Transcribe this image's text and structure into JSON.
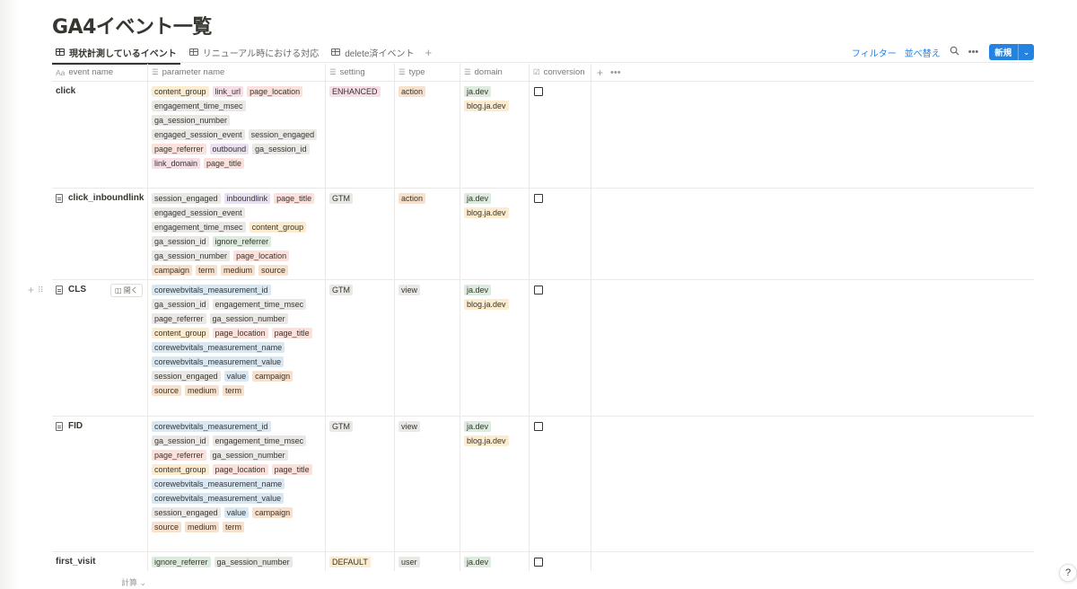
{
  "page": {
    "title": "GA4イベント一覧"
  },
  "views": {
    "tabs": [
      {
        "label": "現状計測しているイベント",
        "active": true
      },
      {
        "label": "リニューアル時における対応",
        "active": false
      },
      {
        "label": "delete済イベント",
        "active": false
      }
    ],
    "add_label": "+"
  },
  "toolbar": {
    "filter_label": "フィルター",
    "sort_label": "並べ替え",
    "search_icon": "search-icon",
    "more_icon": "more-icon",
    "new_label": "新規",
    "new_drop": "⌄"
  },
  "columns": [
    {
      "key": "event",
      "label": "event name",
      "icon": "Aa"
    },
    {
      "key": "param",
      "label": "parameter name",
      "icon": "☰"
    },
    {
      "key": "setting",
      "label": "setting",
      "icon": "☰"
    },
    {
      "key": "type",
      "label": "type",
      "icon": "☰"
    },
    {
      "key": "domain",
      "label": "domain",
      "icon": "☰"
    },
    {
      "key": "conv",
      "label": "conversion",
      "icon": "☑"
    }
  ],
  "tag_colors": {
    "yellow": "#fbecd0",
    "pink": "#f6dde7",
    "red": "#fbe0dc",
    "gray": "#e9e8e5",
    "purple": "#e9e0f2",
    "blue": "#d8e7f2",
    "green": "#dcebdd",
    "orange": "#f8e1cc",
    "brown": "#efe2d8"
  },
  "rows": [
    {
      "name": "click",
      "doc_icon": false,
      "params": [
        [
          "content_group",
          "yellow"
        ],
        [
          "link_url",
          "pink"
        ],
        [
          "page_location",
          "red"
        ],
        [
          "engagement_time_msec",
          "gray"
        ],
        [
          "ga_session_number",
          "gray"
        ],
        [
          "engaged_session_event",
          "gray"
        ],
        [
          "session_engaged",
          "gray"
        ],
        [
          "page_referrer",
          "red"
        ],
        [
          "outbound",
          "purple"
        ],
        [
          "ga_session_id",
          "gray"
        ],
        [
          "link_domain",
          "pink"
        ],
        [
          "page_title",
          "red"
        ]
      ],
      "setting": [
        [
          "ENHANCED",
          "pink"
        ]
      ],
      "type": [
        [
          "action",
          "orange"
        ]
      ],
      "domain": [
        [
          "ja.dev",
          "green"
        ],
        [
          "blog.ja.dev",
          "yellow"
        ]
      ],
      "conversion": false
    },
    {
      "name": "click_inboundlink",
      "doc_icon": true,
      "params": [
        [
          "session_engaged",
          "gray"
        ],
        [
          "inboundlink",
          "purple"
        ],
        [
          "page_title",
          "red"
        ],
        [
          "engaged_session_event",
          "gray"
        ],
        [
          "engagement_time_msec",
          "gray"
        ],
        [
          "content_group",
          "yellow"
        ],
        [
          "ga_session_id",
          "gray"
        ],
        [
          "ignore_referrer",
          "green"
        ],
        [
          "ga_session_number",
          "gray"
        ],
        [
          "page_location",
          "red"
        ],
        [
          "campaign",
          "orange"
        ],
        [
          "term",
          "orange"
        ],
        [
          "medium",
          "orange"
        ],
        [
          "source",
          "orange"
        ]
      ],
      "setting": [
        [
          "GTM",
          "gray"
        ]
      ],
      "type": [
        [
          "action",
          "orange"
        ]
      ],
      "domain": [
        [
          "ja.dev",
          "green"
        ],
        [
          "blog.ja.dev",
          "yellow"
        ]
      ],
      "conversion": false
    },
    {
      "name": "CLS",
      "doc_icon": true,
      "hover": true,
      "open_label": "◫ 開く",
      "params": [
        [
          "corewebvitals_measurement_id",
          "blue"
        ],
        [
          "ga_session_id",
          "gray"
        ],
        [
          "engagement_time_msec",
          "gray"
        ],
        [
          "page_referrer",
          "gray"
        ],
        [
          "ga_session_number",
          "gray"
        ],
        [
          "content_group",
          "yellow"
        ],
        [
          "page_location",
          "red"
        ],
        [
          "page_title",
          "red"
        ],
        [
          "corewebvitals_measurement_name",
          "blue"
        ],
        [
          "corewebvitals_measurement_value",
          "blue"
        ],
        [
          "session_engaged",
          "gray"
        ],
        [
          "value",
          "blue"
        ],
        [
          "campaign",
          "orange"
        ],
        [
          "source",
          "orange"
        ],
        [
          "medium",
          "orange"
        ],
        [
          "term",
          "orange"
        ]
      ],
      "setting": [
        [
          "GTM",
          "gray"
        ]
      ],
      "type": [
        [
          "view",
          "gray"
        ]
      ],
      "domain": [
        [
          "ja.dev",
          "green"
        ],
        [
          "blog.ja.dev",
          "yellow"
        ]
      ],
      "conversion": false
    },
    {
      "name": "FID",
      "doc_icon": true,
      "params": [
        [
          "corewebvitals_measurement_id",
          "blue"
        ],
        [
          "ga_session_id",
          "gray"
        ],
        [
          "engagement_time_msec",
          "gray"
        ],
        [
          "page_referrer",
          "red"
        ],
        [
          "ga_session_number",
          "gray"
        ],
        [
          "content_group",
          "yellow"
        ],
        [
          "page_location",
          "red"
        ],
        [
          "page_title",
          "red"
        ],
        [
          "corewebvitals_measurement_name",
          "blue"
        ],
        [
          "corewebvitals_measurement_value",
          "blue"
        ],
        [
          "session_engaged",
          "gray"
        ],
        [
          "value",
          "blue"
        ],
        [
          "campaign",
          "orange"
        ],
        [
          "source",
          "orange"
        ],
        [
          "medium",
          "orange"
        ],
        [
          "term",
          "orange"
        ]
      ],
      "setting": [
        [
          "GTM",
          "gray"
        ]
      ],
      "type": [
        [
          "view",
          "gray"
        ]
      ],
      "domain": [
        [
          "ja.dev",
          "green"
        ],
        [
          "blog.ja.dev",
          "yellow"
        ]
      ],
      "conversion": false
    },
    {
      "name": "first_visit",
      "doc_icon": false,
      "params": [
        [
          "ignore_referrer",
          "green"
        ],
        [
          "ga_session_number",
          "gray"
        ]
      ],
      "setting": [
        [
          "DEFAULT",
          "yellow"
        ]
      ],
      "type": [
        [
          "user",
          "gray"
        ]
      ],
      "domain": [
        [
          "ja.dev",
          "green"
        ]
      ],
      "conversion": false
    }
  ],
  "footer": {
    "calc_label": "計算 ⌄",
    "help_label": "?"
  }
}
